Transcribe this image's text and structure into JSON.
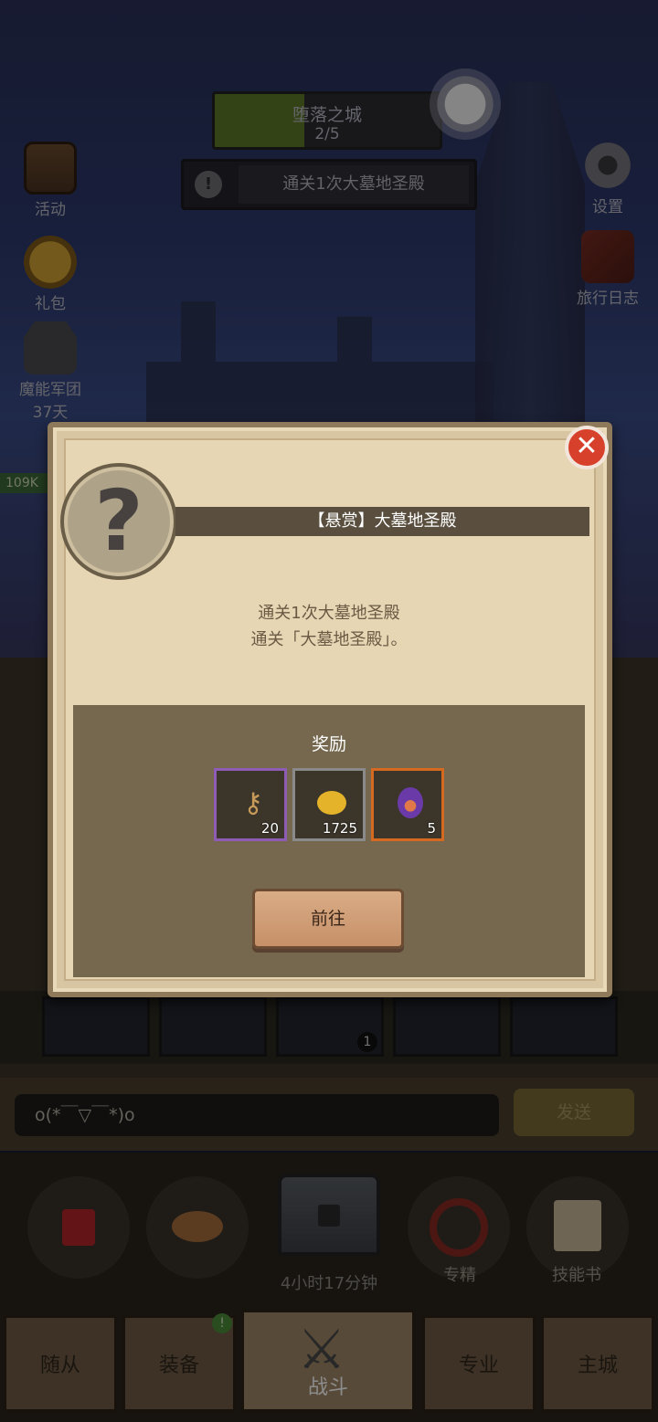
{
  "hud": {
    "stage_name": "堕落之城",
    "stage_progress": "2/5",
    "stage_progress_fraction": 0.4,
    "quest_text": "通关1次大墓地圣殿",
    "level_tag": "109K"
  },
  "side_left": [
    {
      "label": "活动",
      "icon": "events-scroll-icon"
    },
    {
      "label": "礼包",
      "icon": "gift-coin-icon"
    },
    {
      "label": "魔能军团",
      "sub": "37天",
      "icon": "legion-icon"
    }
  ],
  "side_right": [
    {
      "label": "设置",
      "icon": "gear-icon"
    },
    {
      "label": "旅行日志",
      "icon": "journal-icon"
    }
  ],
  "modal": {
    "title": "【悬赏】大墓地圣殿",
    "desc_line1": "通关1次大墓地圣殿",
    "desc_line2": "通关「大墓地圣殿」。",
    "reward_title": "奖励",
    "rewards": [
      {
        "icon": "key-icon",
        "count": "20",
        "rarity_color": "#8e5bb5"
      },
      {
        "icon": "gold-coin-icon",
        "count": "1725",
        "rarity_color": "#8a8a8a"
      },
      {
        "icon": "purple-gem-icon",
        "count": "5",
        "rarity_color": "#d4691f"
      }
    ],
    "go_button": "前往",
    "close_icon": "close-icon"
  },
  "skill_slot_badge": "1",
  "chat": {
    "input_value": "o(*￣▽￣*)o",
    "send_label": "发送"
  },
  "actions": [
    {
      "label": "",
      "icon": "potion-icon"
    },
    {
      "label": "",
      "icon": "bread-icon"
    },
    {
      "label": "4小时17分钟",
      "icon": "treasure-chest-icon"
    },
    {
      "label": "专精",
      "icon": "specialization-icon"
    },
    {
      "label": "技能书",
      "icon": "skill-book-icon"
    }
  ],
  "tabs": [
    {
      "label": "随从"
    },
    {
      "label": "装备",
      "badge": "!"
    },
    {
      "label": "战斗",
      "icon": "crossed-swords-icon"
    },
    {
      "label": "专业"
    },
    {
      "label": "主城"
    }
  ]
}
